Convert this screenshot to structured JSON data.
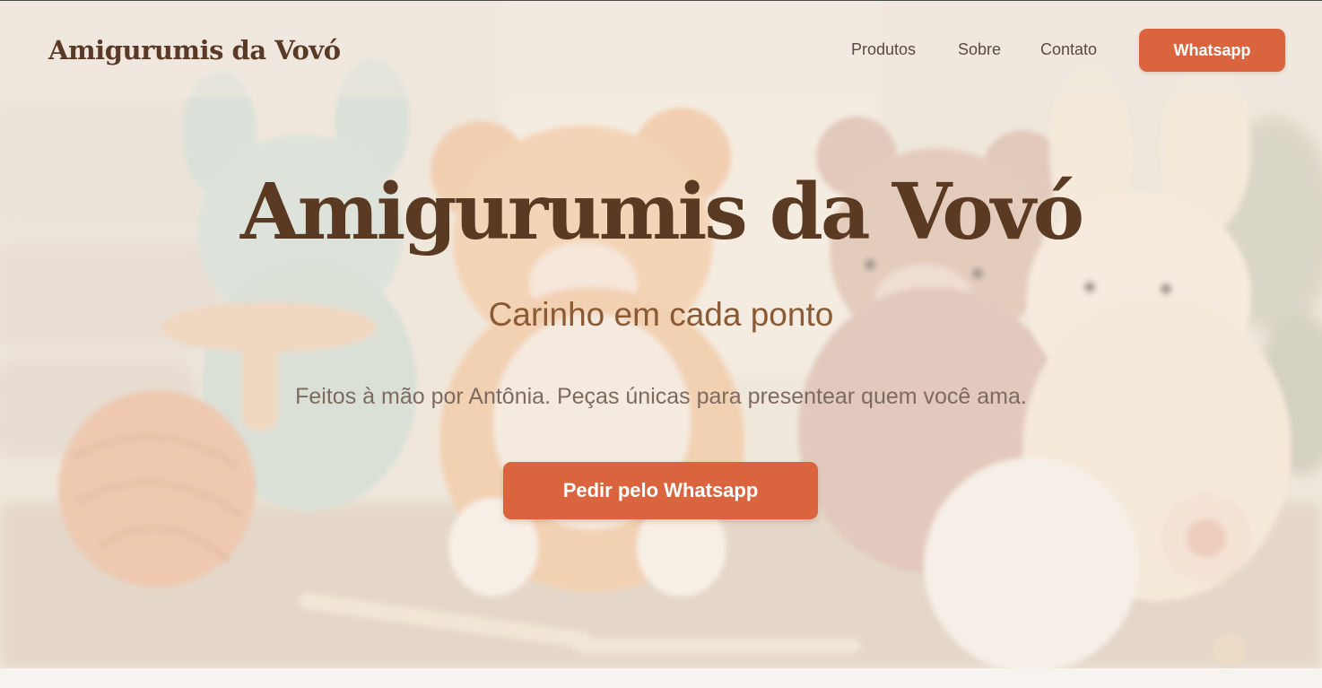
{
  "navbar": {
    "brand": "Amigurumis da Vovó",
    "links": [
      "Produtos",
      "Sobre",
      "Contato"
    ],
    "whatsapp_label": "Whatsapp"
  },
  "hero": {
    "title": "Amigurumis da Vovó",
    "subtitle": "Carinho em cada ponto",
    "description": "Feitos à mão por Antônia. Peças únicas para presentear quem você ama.",
    "cta_label": "Pedir pelo Whatsapp",
    "background": "crochet-toys-photo"
  },
  "colors": {
    "accent": "#d9643e",
    "brand_text": "#5a3a27",
    "subtitle": "#8a5a34",
    "body_text": "#7d6a60",
    "page_background": "#f7f4ef"
  }
}
